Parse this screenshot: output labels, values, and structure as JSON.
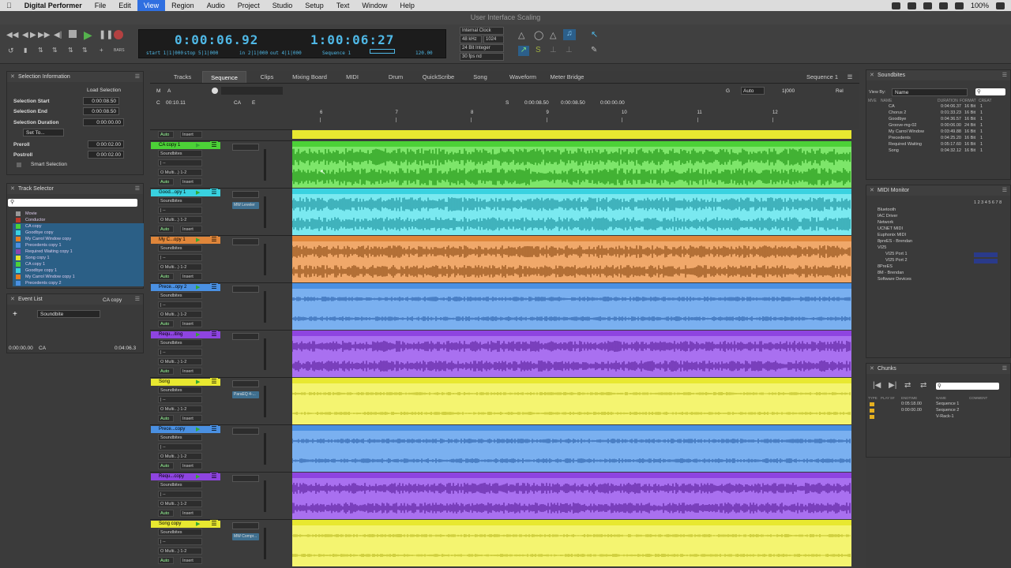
{
  "menubar": {
    "app": "Digital Performer",
    "items": [
      "File",
      "Edit",
      "View",
      "Region",
      "Audio",
      "Project",
      "Studio",
      "Setup",
      "Text",
      "Window",
      "Help"
    ],
    "selected": "View",
    "battery": "100%"
  },
  "window": {
    "title": "User Interface Scaling"
  },
  "transport": {
    "counter_main": "0:00:06.92",
    "counter_secondary": "1:00:06:27",
    "start": "start 1|1|000",
    "stop": "stop 5|1|000",
    "in": "in 2|1|000",
    "out": "out 4|1|000",
    "sequence": "Sequence 1",
    "tempo": "120.00",
    "clock": "Internal Clock",
    "rate": "48 kHz",
    "buffer": "1024",
    "bits": "24 Bit Integer",
    "fps": "30 fps nd",
    "bars_label": "BARS"
  },
  "selection_info": {
    "title": "Selection Information",
    "load": "Load Selection",
    "start_label": "Selection Start",
    "start": "0:00:08.50",
    "end_label": "Selection End",
    "end": "0:00:08.50",
    "duration_label": "Selection Duration",
    "duration": "0:00:00.00",
    "set_to": "Set To...",
    "preroll_label": "Preroll",
    "preroll": "0:00:02.00",
    "postroll_label": "Postroll",
    "postroll": "0:00:02.00",
    "smart": "Smart Selection"
  },
  "track_selector": {
    "title": "Track Selector",
    "items": [
      {
        "name": "Movie",
        "color": "#999"
      },
      {
        "name": "Conductor",
        "color": "#c0392b"
      },
      {
        "name": "CA copy",
        "color": "#4cd137"
      },
      {
        "name": "Goodbye copy",
        "color": "#39d2e0"
      },
      {
        "name": "My Carrol Window copy",
        "color": "#e67e22"
      },
      {
        "name": "Precedents copy 1",
        "color": "#4a90e2"
      },
      {
        "name": "Required Waiting copy 1",
        "color": "#8e44ad"
      },
      {
        "name": "Song copy 1",
        "color": "#e5e52d"
      },
      {
        "name": "CA copy 1",
        "color": "#4cd137"
      },
      {
        "name": "Goodbye copy 1",
        "color": "#39d2e0"
      },
      {
        "name": "My Carrol Window copy 1",
        "color": "#e67e22"
      },
      {
        "name": "Precedents copy 2",
        "color": "#4a90e2"
      }
    ]
  },
  "event_list": {
    "title": "Event List",
    "track": "CA copy",
    "filter": "Soundbite",
    "row_time": "0:00:00.00",
    "row_name": "CA",
    "row_length": "0:04:06.3"
  },
  "tabs": [
    {
      "label": "Tracks"
    },
    {
      "label": "Sequence"
    },
    {
      "label": "Clips"
    },
    {
      "label": "Mixing Board"
    },
    {
      "label": "MIDI"
    },
    {
      "label": "Drum"
    },
    {
      "label": "QuickScribe"
    },
    {
      "label": "Song"
    },
    {
      "label": "Waveform"
    },
    {
      "label": "Meter Bridge"
    }
  ],
  "active_tab": "Sequence",
  "sequence_menu": "Sequence 1",
  "toolbar": {
    "m": "M",
    "a": "A",
    "c": "C",
    "time": "00:10.11",
    "ca": "CA",
    "e": "E",
    "g": "G",
    "auto": "Auto",
    "grid": "1|000",
    "rel": "Rel",
    "s": "S",
    "sel_start": "0:00:08.50",
    "sel_end": "0:00:08.50",
    "sel_dur": "0:00:00.00"
  },
  "ruler": {
    "marks": [
      "6",
      "7",
      "8",
      "9",
      "10",
      "11",
      "12"
    ]
  },
  "tracks": [
    {
      "name": "CA copy 1",
      "color": "#4cd137",
      "light": "#7de66a",
      "sub": [
        "Soundbites",
        "| --",
        "O Multi...) 1-2"
      ],
      "plug": ""
    },
    {
      "name": "Good...opy 1",
      "color": "#39d2e0",
      "light": "#7ae9f0",
      "sub": [
        "Soundbites",
        "| --",
        "O Multi...) 1-2"
      ],
      "plug": "MW Leveler"
    },
    {
      "name": "My C...opy 1",
      "color": "#e0863a",
      "light": "#f0a86a",
      "sub": [
        "Soundbites",
        "| --",
        "O Multi...) 1-2"
      ],
      "plug": ""
    },
    {
      "name": "Prece...opy 2",
      "color": "#4a90e2",
      "light": "#7ab0f0",
      "sub": [
        "Soundbites",
        "| --",
        "O Multi...) 1-2"
      ],
      "plug": ""
    },
    {
      "name": "Requ...iting",
      "color": "#8e44e0",
      "light": "#a970f0",
      "sub": [
        "Soundbites",
        "| --",
        "O Multi...) 1-2"
      ],
      "plug": ""
    },
    {
      "name": "Song",
      "color": "#e8e830",
      "light": "#f4f470",
      "sub": [
        "Soundbites",
        "| --",
        "O Multi...) 1-2"
      ],
      "plug": "ParaEQ 4-..."
    },
    {
      "name": "Prece...copy",
      "color": "#4a90e2",
      "light": "#7ab0f0",
      "sub": [
        "Soundbites",
        "| --",
        "O Multi...) 1-2"
      ],
      "plug": ""
    },
    {
      "name": "Requ...copy",
      "color": "#8e44e0",
      "light": "#a970f0",
      "sub": [
        "Soundbites",
        "| --",
        "O Multi...) 1-2"
      ],
      "plug": ""
    },
    {
      "name": "Song copy",
      "color": "#e8e830",
      "light": "#f4f470",
      "sub": [
        "Soundbites",
        "| --",
        "O Multi...) 1-2"
      ],
      "plug": "MW Compr..."
    }
  ],
  "auto_label": "Auto",
  "insert_label": "Insert",
  "soundbites": {
    "title": "Soundbites",
    "view_by": "View By:",
    "view_value": "Name",
    "cols": [
      "MVE",
      "NAME",
      "DURATION",
      "FORMAT",
      "CREAT"
    ],
    "rows": [
      {
        "name": "CA",
        "duration": "0:04:06.37",
        "format": "16 Bit",
        "c": "1"
      },
      {
        "name": "Chorus 2",
        "duration": "0:01:33.23",
        "format": "16 Bit",
        "c": "1"
      },
      {
        "name": "Goodbye",
        "duration": "0:04:36.57",
        "format": "16 Bit",
        "c": "1"
      },
      {
        "name": "Groove-mg-02",
        "duration": "0:00:06.00",
        "format": "24 Bit",
        "c": "1"
      },
      {
        "name": "My Carrol Window",
        "duration": "0:03:49.88",
        "format": "16 Bit",
        "c": "1"
      },
      {
        "name": "Precedents",
        "duration": "0:04:25.20",
        "format": "16 Bit",
        "c": "1"
      },
      {
        "name": "Required Waiting",
        "duration": "0:05:17.60",
        "format": "16 Bit",
        "c": "1"
      },
      {
        "name": "Song",
        "duration": "0:04:32.12",
        "format": "16 Bit",
        "c": "1"
      }
    ]
  },
  "midi_monitor": {
    "title": "MIDI Monitor",
    "channels": "1 2 3 4 5 6 7 8",
    "items": [
      "Bluetooth",
      "IAC Driver",
      "Network",
      "UCNET MIDI",
      "Euphonix MIDI",
      "8preES - Brendan",
      "VI25",
      "VI25 Port 1",
      "VI25 Port 2",
      "8PreES",
      "8M - Brendan",
      "Software Devices"
    ]
  },
  "chunks": {
    "title": "Chunks",
    "cols": [
      "TYPE",
      "PLAY",
      "S#",
      "ENDTIME",
      "NAME",
      "COMMENT"
    ],
    "rows": [
      {
        "end": "0:05:18.00",
        "name": "Sequence 1"
      },
      {
        "end": "0:00:00.00",
        "name": "Sequence 2"
      },
      {
        "end": "",
        "name": "V-Rack-1"
      }
    ]
  }
}
